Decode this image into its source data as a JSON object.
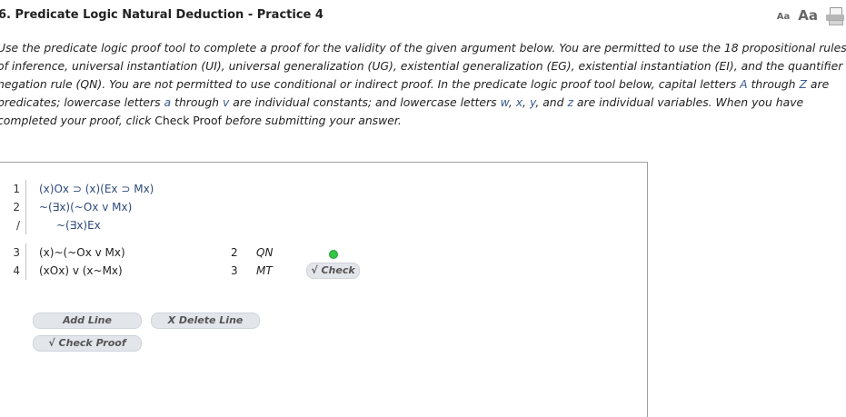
{
  "header": {
    "title": "6. Predicate Logic Natural Deduction - Practice 4",
    "font_small": "Aa",
    "font_large": "Aa",
    "print_icon": "printer-icon"
  },
  "instructions": {
    "t1": "Use the predicate logic proof tool to complete a proof for the validity of the given argument below. You are permitted to use the 18 propositional rules of inference, universal instantiation (UI), universal generalization (UG), existential generalization (EG), existential instantiation (EI), and the quantifier negation rule (QN). You are not permitted to use conditional or indirect proof. In the predicate logic proof tool below, capital letters ",
    "A": "A",
    "t2": " through ",
    "Z": "Z",
    "t3": " are predicates; lowercase letters ",
    "a": "a",
    "t4": " through ",
    "v": "v",
    "t5": " are individual constants; and lowercase letters ",
    "w": "w",
    "c1": ", ",
    "x": "x",
    "c2": ", ",
    "y": "y",
    "c3": ", and ",
    "z": "z",
    "t6": " are individual variables. When you have completed your proof, click ",
    "check_proof": "Check Proof",
    "t7": " before submitting your answer."
  },
  "proof": {
    "premises": [
      {
        "num": "1",
        "formula": "(x)Ox ⊃ (x)(Ex ⊃ Mx)"
      },
      {
        "num": "2",
        "formula": "~(∃x)(~Ox v Mx)"
      }
    ],
    "conclusion": {
      "num": "/",
      "formula": "~(∃x)Ex"
    },
    "lines": [
      {
        "num": "3",
        "formula": "(x)~(~Ox v Mx)",
        "just_line": "2",
        "just_rule": "QN"
      },
      {
        "num": "4",
        "formula": "(xOx) v (x~Mx)",
        "just_line": "3",
        "just_rule": "MT"
      }
    ],
    "status_color": "#35c447",
    "check_line_label": "√ Check"
  },
  "buttons": {
    "add_line": "Add Line",
    "delete_line": "X  Delete Line",
    "check_proof": "√  Check Proof"
  }
}
